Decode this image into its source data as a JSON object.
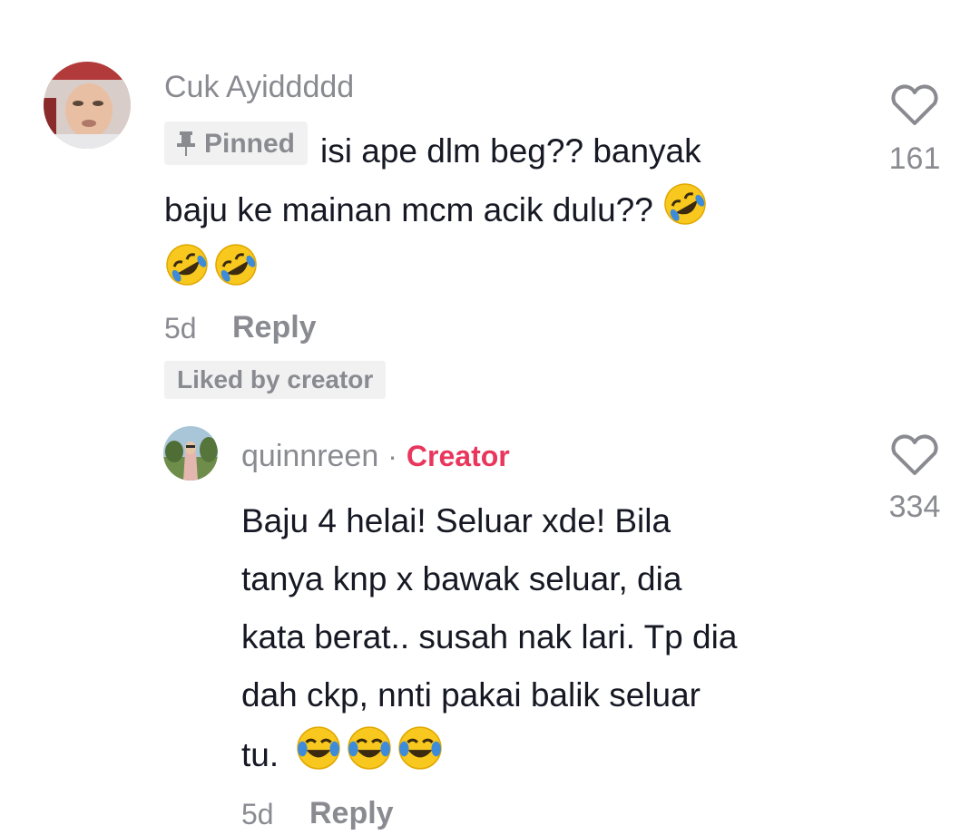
{
  "comments": [
    {
      "username": "Cuk Ayiddddd",
      "pinned_label": "Pinned",
      "text_line1": "isi ape dlm beg?? banyak",
      "text_line2": "baju ke mainan mcm acik dulu??",
      "time": "5d",
      "reply_label": "Reply",
      "liked_by_creator": "Liked by creator",
      "like_count": "161",
      "emoji": "rolling-on-floor-laughing"
    },
    {
      "username": "quinnreen",
      "separator": "·",
      "badge": "Creator",
      "lines": [
        "Baju 4 helai! Seluar xde! Bila",
        "tanya knp x bawak seluar, dia",
        "kata berat.. susah nak lari. Tp dia",
        "dah ckp, nnti pakai balik seluar",
        "tu."
      ],
      "time": "5d",
      "reply_label": "Reply",
      "like_count": "334",
      "emoji": "face-with-tears-of-joy"
    }
  ],
  "icons": {
    "like": "heart-outline-icon",
    "pin": "pin-icon"
  },
  "colors": {
    "creator_accent": "#e8365d",
    "muted_text": "#8a8b91",
    "badge_bg": "#f1f1f2",
    "text": "#161823"
  }
}
